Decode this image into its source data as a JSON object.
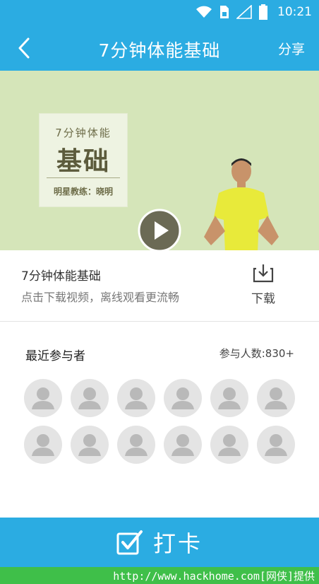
{
  "status_bar": {
    "time": "10:21",
    "icons": [
      "wifi-icon",
      "sim-card-icon",
      "signal-icon",
      "battery-icon"
    ]
  },
  "header": {
    "title": "7分钟体能基础",
    "share_label": "分享",
    "back_icon": "chevron-left-icon",
    "background_color": "#2bace2"
  },
  "video": {
    "poster_line1": "7分钟体能",
    "poster_line2": "基础",
    "poster_coach": "明星教练：晓明",
    "play_icon": "play-icon"
  },
  "info": {
    "title": "7分钟体能基础",
    "subtitle": "点击下载视频，离线观看更流畅",
    "download_label": "下载",
    "download_icon": "download-icon"
  },
  "participants": {
    "title": "最近参与者",
    "count_label": "参与人数:830+",
    "avatar_icon": "avatar-placeholder-icon",
    "avatar_count": 12
  },
  "checkin": {
    "label": "打卡",
    "icon": "checkbox-checked-icon"
  },
  "watermark": {
    "text": "http://www.hackhome.com[网侠]提供"
  }
}
